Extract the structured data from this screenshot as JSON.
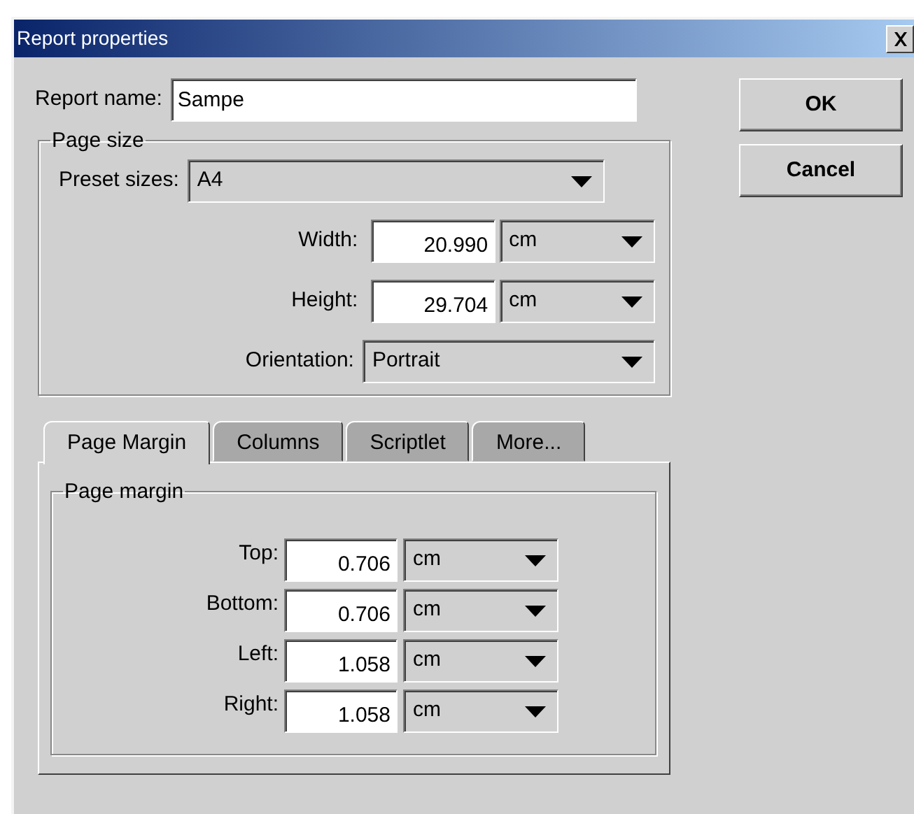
{
  "window": {
    "title": "Report properties"
  },
  "report_name": {
    "label": "Report name:",
    "value": "Sampe"
  },
  "buttons": [
    {
      "label": "OK"
    },
    {
      "label": "Cancel"
    }
  ],
  "page_size": {
    "title": "Page size",
    "preset": {
      "label": "Preset sizes:",
      "value": "A4"
    },
    "fields": [
      {
        "label": "Width:",
        "value": "20.990",
        "unit": "cm"
      },
      {
        "label": "Height:",
        "value": "29.704",
        "unit": "cm"
      }
    ],
    "orientation": {
      "label": "Orientation:",
      "value": "Portrait"
    }
  },
  "tabs": [
    {
      "label": "Page Margin",
      "selected": true
    },
    {
      "label": "Columns",
      "selected": false
    },
    {
      "label": "Scriptlet",
      "selected": false
    },
    {
      "label": "More...",
      "selected": false
    }
  ],
  "page_margin": {
    "title": "Page margin",
    "rows": [
      {
        "label": "Top:",
        "value": "0.706",
        "unit": "cm"
      },
      {
        "label": "Bottom:",
        "value": "0.706",
        "unit": "cm"
      },
      {
        "label": "Left:",
        "value": "1.058",
        "unit": "cm"
      },
      {
        "label": "Right:",
        "value": "1.058",
        "unit": "cm"
      }
    ]
  }
}
